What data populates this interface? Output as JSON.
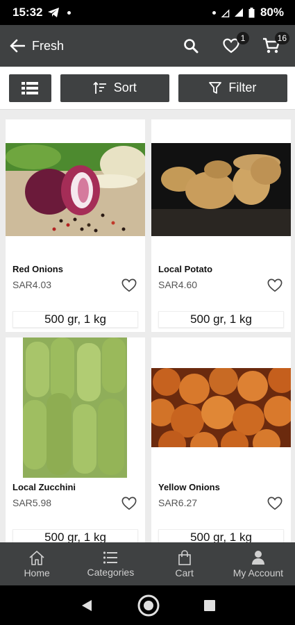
{
  "status_bar": {
    "time": "15:32",
    "battery": "80%"
  },
  "app_bar": {
    "title": "Fresh",
    "wishlist_count": "1",
    "cart_count": "16"
  },
  "toolbar": {
    "sort_label": "Sort",
    "filter_label": "Filter"
  },
  "products": [
    {
      "name": "Red Onions",
      "price": "SAR4.03",
      "variant": "500 gr, 1 kg"
    },
    {
      "name": "Local Potato",
      "price": "SAR4.60",
      "variant": "500 gr, 1 kg"
    },
    {
      "name": "Local Zucchini",
      "price": "SAR5.98",
      "variant": "500 gr, 1 kg"
    },
    {
      "name": "Yellow Onions",
      "price": "SAR6.27",
      "variant": "500 gr, 1 kg"
    }
  ],
  "bottom_nav": {
    "home": "Home",
    "categories": "Categories",
    "cart": "Cart",
    "account": "My Account"
  },
  "colors": {
    "app_bar": "#3f4142",
    "nav_text": "#d0d0d0"
  }
}
